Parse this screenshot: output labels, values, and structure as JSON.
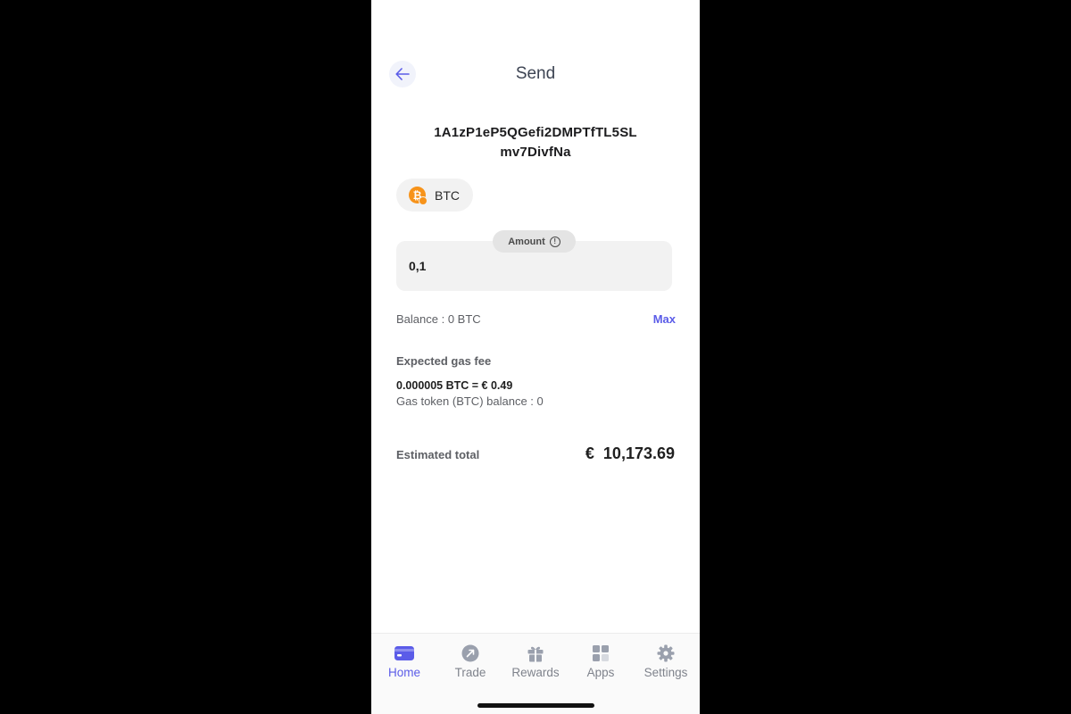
{
  "header": {
    "title": "Send"
  },
  "recipient": {
    "address_line1": "1A1zP1eP5QGefi2DMPTfTL5SL",
    "address_line2": "mv7DivfNa"
  },
  "token": {
    "symbol": "BTC",
    "icon": "bitcoin-icon",
    "color": "#f7931a"
  },
  "amount": {
    "label": "Amount",
    "value": "0,1",
    "info_icon": "info-icon"
  },
  "balance": {
    "label": "Balance : ",
    "value": "0 BTC",
    "max_label": "Max"
  },
  "gas": {
    "label": "Expected gas fee",
    "value": "0.000005 BTC = € 0.49",
    "token_balance": "Gas token (BTC) balance : 0"
  },
  "total": {
    "label": "Estimated total",
    "currency": "€",
    "value": "10,173.69"
  },
  "tabs": [
    {
      "label": "Home",
      "icon": "wallet-icon",
      "active": true
    },
    {
      "label": "Trade",
      "icon": "swap-icon",
      "active": false
    },
    {
      "label": "Rewards",
      "icon": "gift-icon",
      "active": false
    },
    {
      "label": "Apps",
      "icon": "grid-icon",
      "active": false
    },
    {
      "label": "Settings",
      "icon": "gear-icon",
      "active": false
    }
  ],
  "colors": {
    "accent": "#5b5ce8",
    "muted_icon": "#9aa0ad"
  }
}
